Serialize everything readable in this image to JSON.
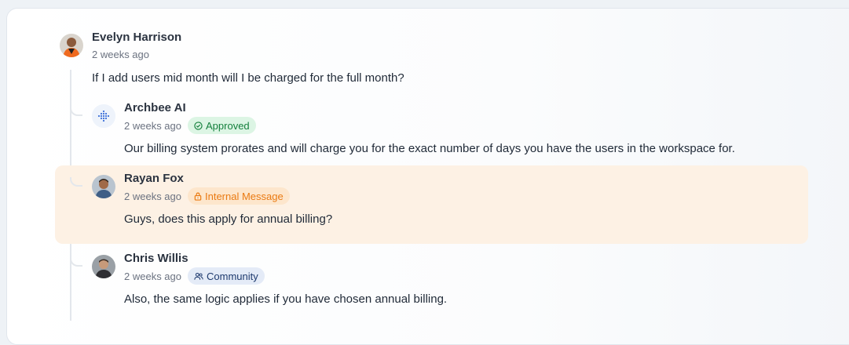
{
  "thread": {
    "root": {
      "author": "Evelyn Harrison",
      "time": "2 weeks ago",
      "text": "If I add users mid month will I be charged for the full month?",
      "avatar_icon": "user-avatar-evelyn"
    },
    "replies": [
      {
        "author": "Archbee AI",
        "time": "2 weeks ago",
        "badge": {
          "label": "Approved",
          "icon": "check-circle-icon",
          "color": "#15803d"
        },
        "text": "Our billing system prorates and will charge you for the exact number of days you have the users in the workspace for.",
        "avatar_icon": "archbee-logo-icon"
      },
      {
        "author": "Rayan Fox",
        "time": "2 weeks ago",
        "badge": {
          "label": "Internal Message",
          "icon": "lock-icon",
          "color": "#ea7a12"
        },
        "text": "Guys, does this apply for annual billing?",
        "avatar_icon": "user-avatar-rayan",
        "highlight_color": "#fdf1e4"
      },
      {
        "author": "Chris Willis",
        "time": "2 weeks ago",
        "badge": {
          "label": "Community",
          "icon": "users-icon",
          "color": "#1e3a6e"
        },
        "text": "Also, the same logic applies if you have chosen annual billing.",
        "avatar_icon": "user-avatar-chris"
      }
    ]
  }
}
